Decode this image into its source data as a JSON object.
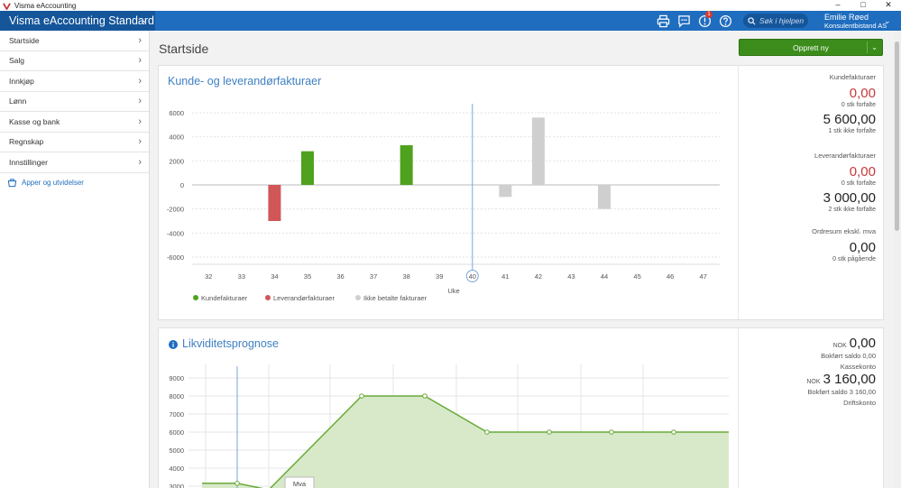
{
  "window": {
    "title": "Visma eAccounting",
    "controls": [
      "–",
      "□",
      "✕"
    ]
  },
  "header": {
    "brand": "Visma eAccounting Standard",
    "notification_count": "1",
    "search_placeholder": "Søk i hjelpen",
    "user_name": "Emilie Røed",
    "company": "Konsulentbistand AS",
    "icons": [
      "print-icon",
      "chat-icon",
      "notification-icon",
      "help-icon",
      "search-icon"
    ]
  },
  "sidebar": {
    "items": [
      {
        "label": "Startside"
      },
      {
        "label": "Salg"
      },
      {
        "label": "Innkjøp"
      },
      {
        "label": "Lønn"
      },
      {
        "label": "Kasse og bank"
      },
      {
        "label": "Regnskap"
      },
      {
        "label": "Innstillinger"
      }
    ],
    "apps_label": "Apper og utvidelser"
  },
  "main": {
    "title": "Startside",
    "create_button": "Opprett ny"
  },
  "invoices": {
    "title": "Kunde- og leverandørfakturaer",
    "customer": {
      "label": "Kundefakturaer",
      "overdue_amount": "0,00",
      "overdue_text": "0 stk forfalte",
      "not_due_amount": "5 600,00",
      "not_due_text": "1 stk ikke forfalte"
    },
    "supplier": {
      "label": "Leverandørfakturaer",
      "overdue_amount": "0,00",
      "overdue_text": "0 stk forfalte",
      "not_due_amount": "3 000,00",
      "not_due_text": "2 stk ikke forfalte"
    },
    "orders": {
      "label": "Ordresum ekskl. mva",
      "amount": "0,00",
      "text": "0 stk pågående"
    }
  },
  "liquidity": {
    "title": "Likviditetsprognose",
    "cash": {
      "currency": "NOK",
      "amount": "0,00",
      "booked": "Bokført saldo  0,00",
      "account": "Kassekonto"
    },
    "operating": {
      "currency": "NOK",
      "amount": "3 160,00",
      "booked": "Bokført saldo  3 160,00",
      "account": "Driftskonto"
    },
    "tooltip": "Mva"
  },
  "chart_data": [
    {
      "type": "bar",
      "xlabel": "Uke",
      "ylabel": "",
      "ylim": [
        -6000,
        6000
      ],
      "yticks": [
        6000,
        4000,
        2000,
        0,
        -2000,
        -4000,
        -6000
      ],
      "categories": [
        "32",
        "33",
        "34",
        "35",
        "36",
        "37",
        "38",
        "39",
        "40",
        "41",
        "42",
        "43",
        "44",
        "45",
        "46",
        "47"
      ],
      "current": "40",
      "series": [
        {
          "name": "Kundefakturaer",
          "color": "#4ea21e",
          "values": [
            0,
            0,
            0,
            2800,
            0,
            0,
            3300,
            0,
            0,
            0,
            0,
            0,
            0,
            0,
            0,
            0
          ]
        },
        {
          "name": "Leverandørfakturaer",
          "color": "#d05658",
          "values": [
            0,
            0,
            -3000,
            0,
            0,
            0,
            0,
            0,
            0,
            0,
            0,
            0,
            0,
            0,
            0,
            0
          ]
        },
        {
          "name": "Ikke betalte fakturaer",
          "color": "#cfcfcf",
          "values": [
            0,
            0,
            0,
            0,
            0,
            0,
            0,
            0,
            0,
            -1000,
            5600,
            0,
            -2000,
            0,
            0,
            0
          ]
        }
      ],
      "grid": true,
      "legend": "bottom-left"
    },
    {
      "type": "area",
      "yticks": [
        9000,
        8000,
        7000,
        6000,
        5000,
        4000,
        3000
      ],
      "series": [
        {
          "name": "",
          "color": "#6aaa3a",
          "values": [
            3160,
            3160,
            2800,
            8000,
            8000,
            6000,
            6000,
            6000,
            6000,
            6000
          ]
        }
      ],
      "grid": true
    }
  ]
}
